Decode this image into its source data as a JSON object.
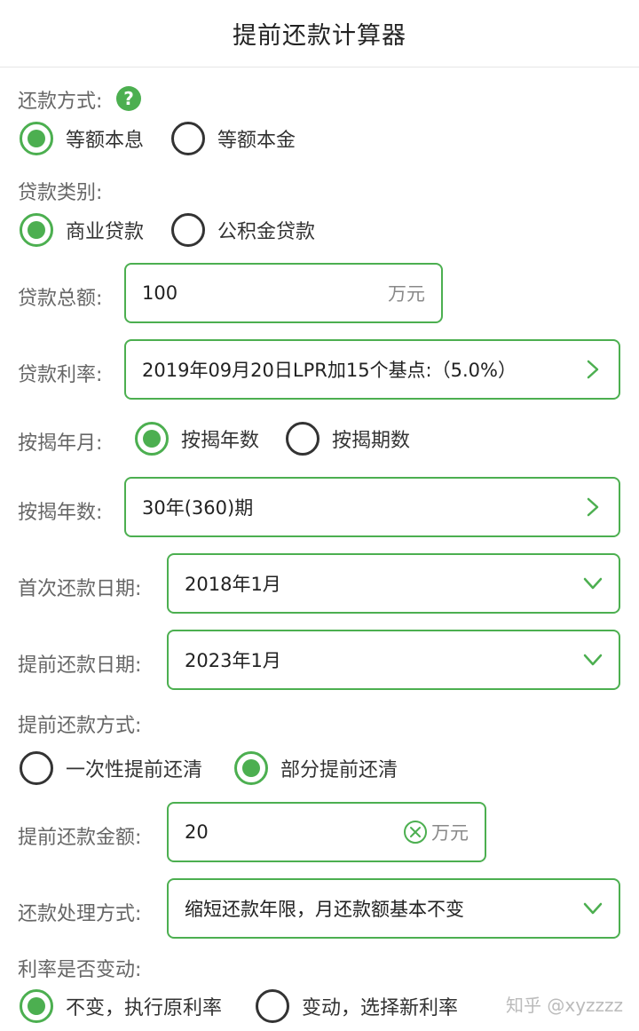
{
  "header": {
    "title": "提前还款计算器"
  },
  "repay_method": {
    "label": "还款方式:",
    "options": [
      "等额本息",
      "等额本金"
    ],
    "selected": 0
  },
  "loan_type": {
    "label": "贷款类别:",
    "options": [
      "商业贷款",
      "公积金贷款"
    ],
    "selected": 0
  },
  "loan_amount": {
    "label": "贷款总额:",
    "value": "100",
    "unit": "万元"
  },
  "loan_rate": {
    "label": "贷款利率:",
    "value": "2019年09月20日LPR加15个基点:（5.0%）"
  },
  "mortgage_mode": {
    "label": "按揭年月:",
    "options": [
      "按揭年数",
      "按揭期数"
    ],
    "selected": 0
  },
  "mortgage_years": {
    "label": "按揭年数:",
    "value": "30年(360)期"
  },
  "first_payment_date": {
    "label": "首次还款日期:",
    "value": "2018年1月"
  },
  "prepay_date": {
    "label": "提前还款日期:",
    "value": "2023年1月"
  },
  "prepay_method": {
    "label": "提前还款方式:",
    "options": [
      "一次性提前还清",
      "部分提前还清"
    ],
    "selected": 1
  },
  "prepay_amount": {
    "label": "提前还款金额:",
    "value": "20",
    "unit": "万元"
  },
  "handling_method": {
    "label": "还款处理方式:",
    "value": "缩短还款年限，月还款额基本不变"
  },
  "rate_change": {
    "label": "利率是否变动:",
    "options": [
      "不变，执行原利率",
      "变动，选择新利率"
    ],
    "selected": 0
  },
  "watermark": "知乎 @xyzzzz",
  "colors": {
    "accent": "#4caf50",
    "label": "#666666",
    "text": "#333333"
  }
}
